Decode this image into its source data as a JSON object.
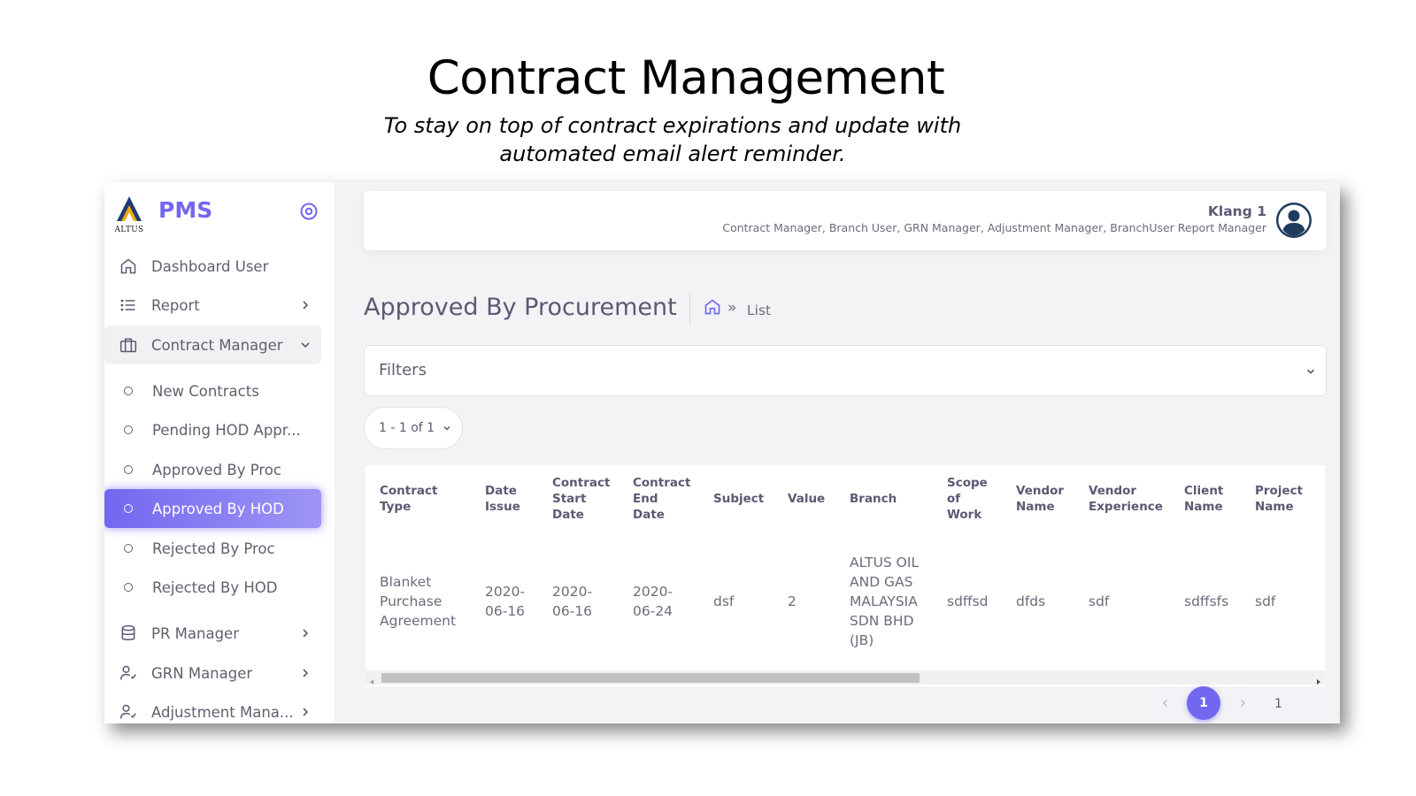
{
  "slide": {
    "title": "Contract Management",
    "subtitle": "To stay on top of contract expirations and update with automated email alert reminder."
  },
  "brand": {
    "logo_text": "ALTUS",
    "name": "PMS",
    "accent_color": "#7367f0"
  },
  "sidebar": {
    "items": [
      {
        "label": "Dashboard User",
        "icon": "home-icon"
      },
      {
        "label": "Report",
        "icon": "list-icon"
      },
      {
        "label": "Contract Manager",
        "icon": "briefcase-icon"
      },
      {
        "label": "New Contracts"
      },
      {
        "label": "Pending HOD Appr..."
      },
      {
        "label": "Approved By Proc"
      },
      {
        "label": "Approved By HOD"
      },
      {
        "label": "Rejected By Proc"
      },
      {
        "label": "Rejected By HOD"
      },
      {
        "label": "PR Manager",
        "icon": "database-icon"
      },
      {
        "label": "GRN Manager",
        "icon": "user-check-icon"
      },
      {
        "label": "Adjustment Mana...",
        "icon": "user-check-icon"
      }
    ]
  },
  "header": {
    "user_name": "Klang 1",
    "user_roles": "Contract Manager, Branch User, GRN Manager, Adjustment Manager, BranchUser Report Manager"
  },
  "page": {
    "title": "Approved By Procurement",
    "breadcrumb_sep": "»",
    "breadcrumb_current": "List"
  },
  "filters": {
    "label": "Filters"
  },
  "pager": {
    "range": "1 - 1 of 1"
  },
  "table": {
    "columns": [
      "Contract Type",
      "Date Issue",
      "Contract Start Date",
      "Contract End Date",
      "Subject",
      "Value",
      "Branch",
      "Scope of Work",
      "Vendor Name",
      "Vendor Experience",
      "Client Name",
      "Project Name"
    ],
    "rows": [
      [
        "Blanket Purchase Agreement",
        "2020-06-16",
        "2020-06-16",
        "2020-06-24",
        "dsf",
        "2",
        "ALTUS OIL AND GAS MALAYSIA SDN BHD (JB)",
        "sdffsd",
        "dfds",
        "sdf",
        "sdffsfs",
        "sdf"
      ]
    ]
  },
  "pagination": {
    "current_page": "1",
    "jump_value": "1"
  }
}
